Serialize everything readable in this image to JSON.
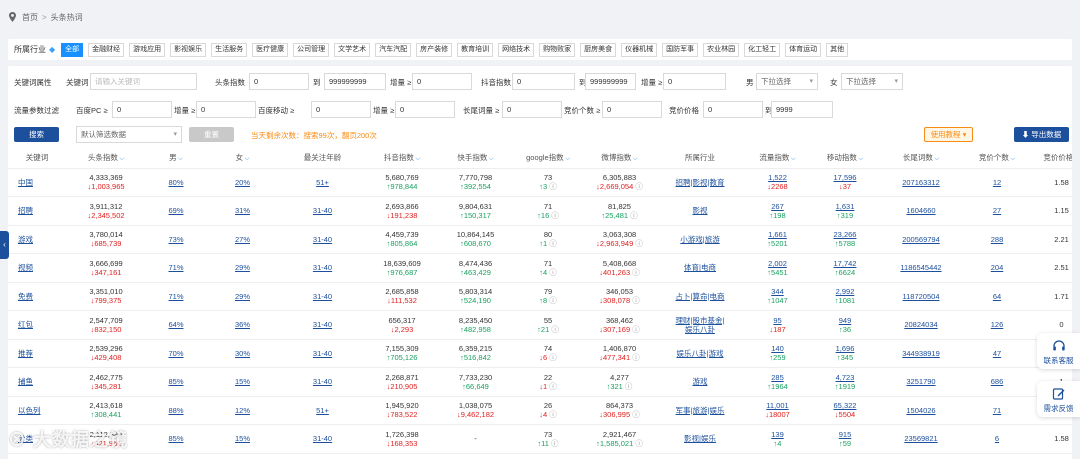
{
  "breadcrumb": {
    "home": "首页",
    "sep": ">",
    "current": "头条热词"
  },
  "industry": {
    "label": "所属行业",
    "tags": [
      "全部",
      "金融财经",
      "游戏应用",
      "影视娱乐",
      "生活服务",
      "医疗健康",
      "公司管理",
      "文学艺术",
      "汽车汽配",
      "房产装修",
      "教育培训",
      "网络技术",
      "购物败家",
      "厨房美食",
      "仪器机械",
      "国防军事",
      "农业林园",
      "化工轻工",
      "体育运动",
      "其他"
    ]
  },
  "filters": {
    "attr_label": "关键词属性",
    "keyword_label": "关键词",
    "keyword_placeholder": "请输入关键词",
    "toutiao_label": "头条指数",
    "toutiao_min": "0",
    "to": "到",
    "toutiao_max": "999999999",
    "growth_label": "增量 ≥",
    "growth_val": "0",
    "douyin_label": "抖音指数",
    "douyin_min": "0",
    "douyin_max": "999999999",
    "male_label": "男",
    "female_label": "女",
    "dropdown": "下拉选择",
    "traffic_label": "流量参数过滤",
    "baidu_pc": "百度PC ≥",
    "baidu_mobile": "百度移动 ≥",
    "longtail": "长尾词量 ≥",
    "bid_count": "竞价个数 ≥",
    "bid_price": "竞价价格",
    "zero": "0",
    "bid_max": "9999"
  },
  "actions": {
    "search": "搜索",
    "default_select": "默认筛选数据",
    "reset": "重置",
    "quota_tip": "当天剩余次数：搜索99次，翻页200次",
    "tutorial": "使用教程 ▾",
    "export": "⬇ 导出数据"
  },
  "table": {
    "headers": [
      "关键词",
      "头条指数",
      "男",
      "女",
      "最关注年龄",
      "抖音指数",
      "快手指数",
      "google指数",
      "微博指数",
      "所属行业",
      "流量指数",
      "移动指数",
      "长尾词数",
      "竞价个数",
      "竞价价格"
    ],
    "rows": [
      {
        "kw": "中国",
        "tt": "4,333,369",
        "ttd": "1,003,965",
        "ttu": false,
        "m": "80%",
        "f": "20%",
        "age": "51+",
        "dy": "5,680,769",
        "dyd": "978,844",
        "dyu": true,
        "ks": "7,770,798",
        "ksd": "392,554",
        "ksu": true,
        "g": "73",
        "gd": "3",
        "gu": true,
        "wb": "6,305,883",
        "wbd": "2,669,054",
        "wbu": false,
        "ind": "招聘|影视|教育",
        "ind2": "",
        "fl": "1,522",
        "fld": "2268",
        "flu": false,
        "mb": "17,596",
        "mbd": "37",
        "mbu": false,
        "lt": "207163312",
        "bc": "12",
        "bp": "1.58"
      },
      {
        "kw": "招聘",
        "tt": "3,911,312",
        "ttd": "2,345,502",
        "ttu": false,
        "m": "69%",
        "f": "31%",
        "age": "31-40",
        "dy": "2,693,866",
        "dyd": "191,238",
        "dyu": false,
        "ks": "9,804,631",
        "ksd": "150,317",
        "ksu": true,
        "g": "71",
        "gd": "16",
        "gu": true,
        "wb": "81,825",
        "wbd": "25,481",
        "wbu": true,
        "ind": "影视",
        "ind2": "",
        "fl": "267",
        "fld": "198",
        "flu": true,
        "mb": "1,631",
        "mbd": "319",
        "mbu": true,
        "lt": "1604660",
        "bc": "27",
        "bp": "1.15"
      },
      {
        "kw": "游戏",
        "tt": "3,780,014",
        "ttd": "685,739",
        "ttu": false,
        "m": "73%",
        "f": "27%",
        "age": "31-40",
        "dy": "4,459,739",
        "dyd": "805,864",
        "dyu": true,
        "ks": "10,864,145",
        "ksd": "608,670",
        "ksu": true,
        "g": "80",
        "gd": "1",
        "gu": true,
        "wb": "3,063,308",
        "wbd": "2,963,949",
        "wbu": false,
        "ind": "小游戏|旅游",
        "ind2": "",
        "fl": "1,661",
        "fld": "5201",
        "flu": true,
        "mb": "23,266",
        "mbd": "5788",
        "mbu": true,
        "lt": "200569794",
        "bc": "288",
        "bp": "2.21"
      },
      {
        "kw": "视频",
        "tt": "3,666,699",
        "ttd": "347,161",
        "ttu": false,
        "m": "71%",
        "f": "29%",
        "age": "31-40",
        "dy": "18,639,609",
        "dyd": "976,687",
        "dyu": true,
        "ks": "8,474,436",
        "ksd": "463,429",
        "ksu": true,
        "g": "71",
        "gd": "4",
        "gu": true,
        "wb": "5,408,668",
        "wbd": "401,263",
        "wbu": false,
        "ind": "体育|电商",
        "ind2": "",
        "fl": "2,002",
        "fld": "5451",
        "flu": true,
        "mb": "17,742",
        "mbd": "6624",
        "mbu": true,
        "lt": "1186545442",
        "bc": "204",
        "bp": "2.51"
      },
      {
        "kw": "免费",
        "tt": "3,351,010",
        "ttd": "799,375",
        "ttu": false,
        "m": "71%",
        "f": "29%",
        "age": "31-40",
        "dy": "2,685,858",
        "dyd": "111,532",
        "dyu": false,
        "ks": "5,803,314",
        "ksd": "524,190",
        "ksu": true,
        "g": "79",
        "gd": "8",
        "gu": true,
        "wb": "346,053",
        "wbd": "308,078",
        "wbu": false,
        "ind": "占卜|算命|电商",
        "ind2": "",
        "fl": "344",
        "fld": "1047",
        "flu": true,
        "mb": "2,992",
        "mbd": "1081",
        "mbu": true,
        "lt": "118720504",
        "bc": "64",
        "bp": "1.71"
      },
      {
        "kw": "红包",
        "tt": "2,547,709",
        "ttd": "832,150",
        "ttu": false,
        "m": "64%",
        "f": "36%",
        "age": "31-40",
        "dy": "656,317",
        "dyd": "2,293",
        "dyu": false,
        "ks": "8,235,450",
        "ksd": "482,958",
        "ksu": true,
        "g": "55",
        "gd": "21",
        "gu": true,
        "wb": "368,462",
        "wbd": "307,169",
        "wbu": false,
        "ind": "理财|股市基金|",
        "ind2": "娱乐八卦",
        "fl": "95",
        "fld": "187",
        "flu": false,
        "mb": "949",
        "mbd": "36",
        "mbu": true,
        "lt": "20824034",
        "bc": "126",
        "bp": "0"
      },
      {
        "kw": "推荐",
        "tt": "2,539,296",
        "ttd": "429,408",
        "ttu": false,
        "m": "70%",
        "f": "30%",
        "age": "31-40",
        "dy": "7,155,309",
        "dyd": "705,126",
        "dyu": true,
        "ks": "6,359,215",
        "ksd": "516,842",
        "ksu": true,
        "g": "74",
        "gd": "6",
        "gu": false,
        "wb": "1,406,870",
        "wbd": "477,341",
        "wbu": false,
        "ind": "娱乐八卦|游戏",
        "ind2": "",
        "fl": "140",
        "fld": "259",
        "flu": true,
        "mb": "1,696",
        "mbd": "345",
        "mbu": true,
        "lt": "344938919",
        "bc": "47",
        "bp": "1"
      },
      {
        "kw": "捕鱼",
        "tt": "2,462,775",
        "ttd": "345,281",
        "ttu": false,
        "m": "85%",
        "f": "15%",
        "age": "31-40",
        "dy": "2,268,871",
        "dyd": "210,905",
        "dyu": false,
        "ks": "7,733,230",
        "ksd": "66,649",
        "ksu": true,
        "g": "22",
        "gd": "1",
        "gu": false,
        "wb": "4,277",
        "wbd": "321",
        "wbu": true,
        "ind": "游戏",
        "ind2": "",
        "fl": "285",
        "fld": "1964",
        "flu": true,
        "mb": "4,723",
        "mbd": "1919",
        "mbu": true,
        "lt": "3251790",
        "bc": "686",
        "bp": "1"
      },
      {
        "kw": "以色列",
        "tt": "2,413,618",
        "ttd": "308,441",
        "ttu": true,
        "m": "88%",
        "f": "12%",
        "age": "51+",
        "dy": "1,945,920",
        "dyd": "783,522",
        "dyu": false,
        "ks": "1,038,075",
        "ksd": "9,462,182",
        "ksu": false,
        "g": "26",
        "gd": "4",
        "gu": false,
        "wb": "864,373",
        "wbd": "306,995",
        "wbu": false,
        "ind": "军事|旅游|娱乐",
        "ind2": "",
        "fl": "11,001",
        "fld": "18007",
        "flu": false,
        "mb": "65,322",
        "mbd": "5504",
        "mbu": false,
        "lt": "1504026",
        "bc": "71",
        "bp": "1"
      },
      {
        "kw": "分类",
        "tt": "2,112,344",
        "ttd": "421,951",
        "ttu": false,
        "m": "85%",
        "f": "15%",
        "age": "31-40",
        "dy": "1,726,398",
        "dyd": "168,353",
        "dyu": false,
        "ks": "-",
        "ksd": "",
        "ksu": true,
        "g": "73",
        "gd": "11",
        "gu": true,
        "wb": "2,921,467",
        "wbd": "1,585,021",
        "wbu": true,
        "ind": "影视|娱乐",
        "ind2": "",
        "fl": "139",
        "fld": "4",
        "flu": true,
        "mb": "915",
        "mbd": "59",
        "mbu": true,
        "lt": "23569821",
        "bc": "6",
        "bp": "1.58"
      }
    ]
  },
  "float": {
    "service": "联系客服",
    "feedback": "需求反馈"
  },
  "side_toggle": "‹",
  "watermark": "⊗ 大数据之镜",
  "colors": {
    "primary": "#1c4f9c",
    "up": "#19a15f",
    "down": "#e02020",
    "orange": "#fa8c16"
  }
}
